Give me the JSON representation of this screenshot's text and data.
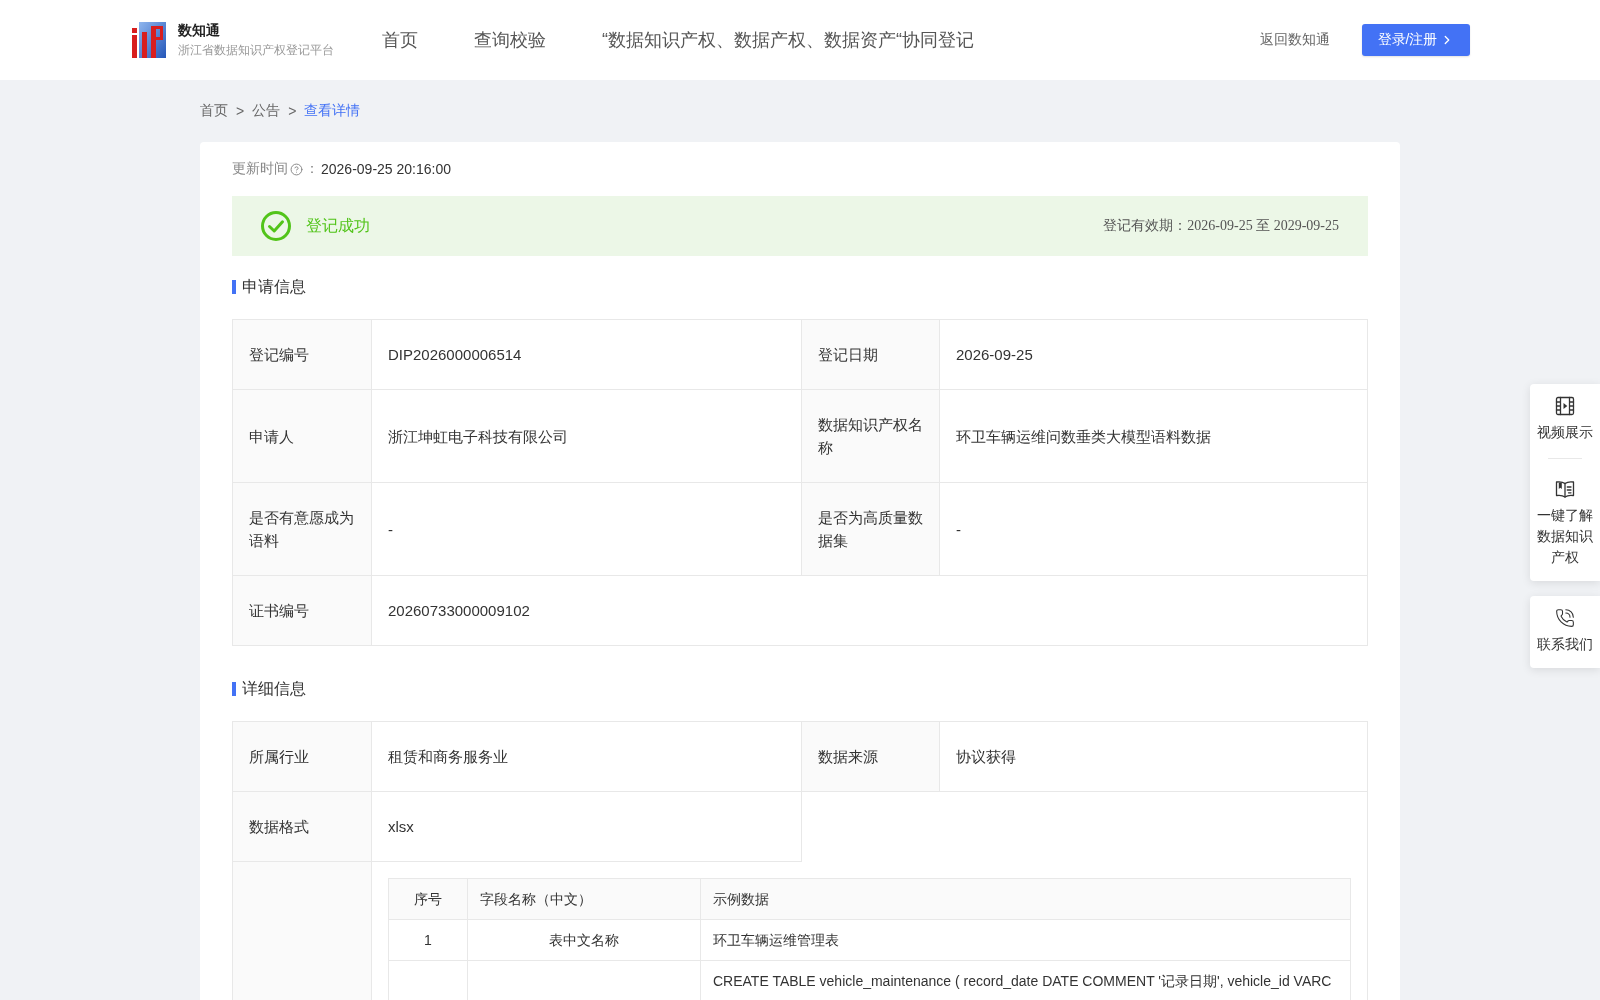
{
  "header": {
    "logo": {
      "title": "数知通",
      "subtitle": "浙江省数据知识产权登记平台"
    },
    "nav": [
      {
        "label": "首页",
        "selected": false
      },
      {
        "label": "查询校验",
        "selected": false
      },
      {
        "label": "“数据知识产权、数据产权、数据资产“协同登记",
        "selected": false
      }
    ],
    "back_link": "返回数知通",
    "login_button": "登录/注册"
  },
  "breadcrumb": [
    {
      "kind": "link",
      "text": "首页"
    },
    {
      "kind": "separator",
      "text": ">"
    },
    {
      "kind": "link",
      "text": "公告"
    },
    {
      "kind": "separator",
      "text": ">"
    },
    {
      "kind": "current",
      "text": "查看详情"
    }
  ],
  "update_time": {
    "label": "更新时间",
    "colon": "：",
    "value": "2026-09-25 20:16:00"
  },
  "banner": {
    "success": true,
    "text": "登记成功",
    "validity": "登记有效期：2026-09-25 至 2029-09-25"
  },
  "sections": [
    {
      "title": "申请信息",
      "rows": [
        {
          "kind": "double",
          "cells": [
            {
              "label": "登记编号",
              "value": "DIP2026000006514"
            },
            {
              "label": "登记日期",
              "value": "2026-09-25"
            }
          ]
        },
        {
          "kind": "double",
          "cells": [
            {
              "label": "申请人",
              "value": "浙江坤虹电子科技有限公司"
            },
            {
              "label": "数据知识产权名称",
              "value": "环卫车辆运维问数垂类大模型语料数据"
            }
          ]
        },
        {
          "kind": "double",
          "cells": [
            {
              "label": "是否有意愿成为语料",
              "value": "-"
            },
            {
              "label": "是否为高质量数据集",
              "value": "-"
            }
          ]
        },
        {
          "kind": "wide",
          "cells": [
            {
              "label": "证书编号",
              "value": "20260733000009102"
            }
          ]
        }
      ]
    },
    {
      "title": "详细信息",
      "rows": [
        {
          "kind": "double",
          "cells": [
            {
              "label": "所属行业",
              "value": "租赁和商务服务业"
            },
            {
              "label": "数据来源",
              "value": "协议获得"
            }
          ]
        },
        {
          "kind": "single",
          "cells": [
            {
              "label": "数据格式",
              "value": "xlsx"
            }
          ]
        },
        {
          "kind": "sample_table",
          "columns": [
            "序号",
            "字段名称（中文）",
            "示例数据"
          ],
          "rows": [
            {
              "index": "1",
              "field": "表中文名称",
              "sample": "环卫车辆运维管理表"
            },
            {
              "sample": "CREATE TABLE vehicle_maintenance ( record_date DATE COMMENT '记录日期', vehicle_id VARC"
            }
          ]
        }
      ]
    }
  ],
  "float_panel": [
    {
      "items": [
        {
          "kind": "video",
          "label": "视频展示"
        },
        {
          "kind": "guide",
          "label": "一键了解数据知识产权"
        }
      ]
    },
    {
      "items": [
        {
          "kind": "phone",
          "label": "联系我们"
        }
      ]
    }
  ]
}
